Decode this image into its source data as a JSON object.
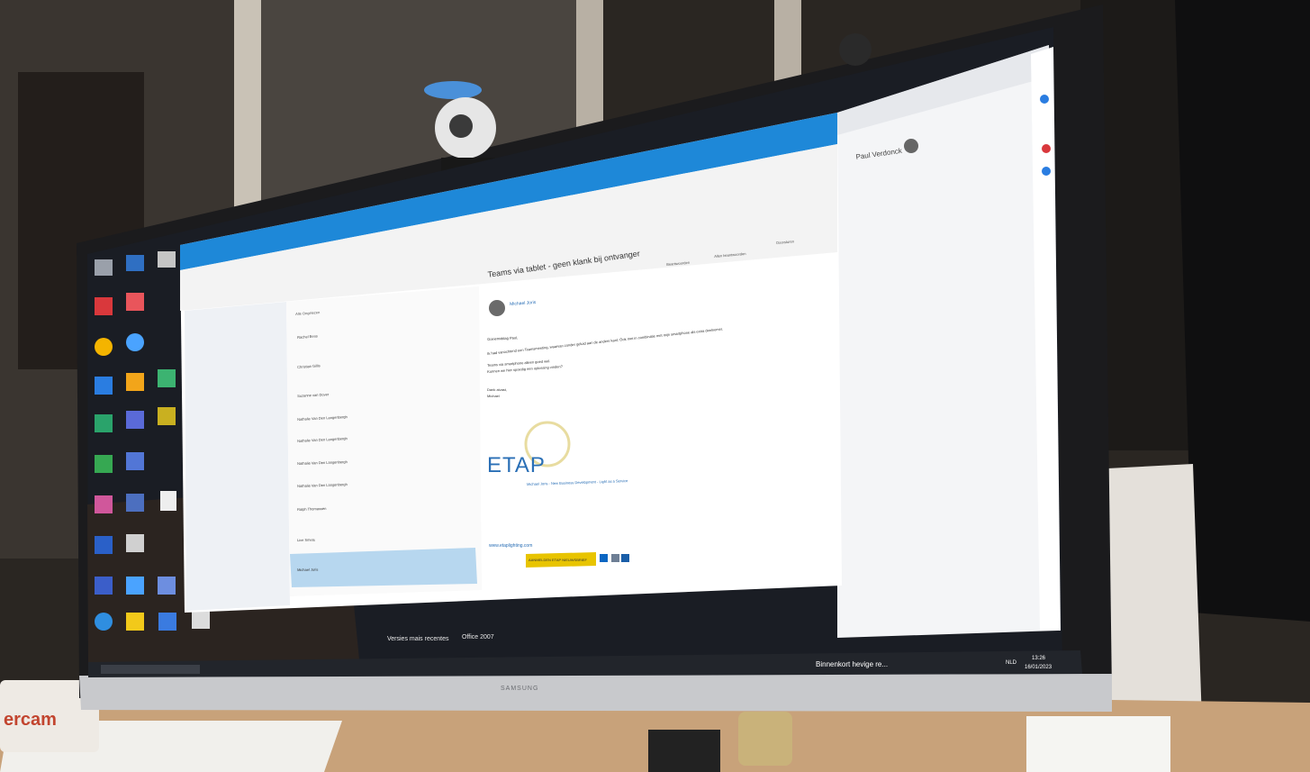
{
  "email": {
    "subject": "Teams via tablet - geen klank bij ontvanger",
    "sender_name": "Michael Joris",
    "greeting": "Goeiemiddag Paul,",
    "body_line_1": "Ik had vanochtend een Teamsmeeting, waarvan zonder geluid aan de andere kant. Ook met in combinatie met mijn smartphone als extra deelnemer.",
    "body_line_2": "Teams via smartphone alleen goed wel.",
    "body_line_3": "Kunnen we hier spoedig een oplossing vinden?",
    "closing": "Dank alvast,",
    "closing_name": "Michael",
    "logo_text": "ETAP",
    "signature_line": "Michael Joris - New Business Development - Light as a Service",
    "website": "www.etaplighting.com",
    "banner": "AANMELDEN ETAP NIEUWSBRIEF"
  },
  "reading_toolbar": {
    "reply_all": "Allen beantwoorden",
    "forward": "Doorsturen",
    "reply": "Beantwoorden"
  },
  "browser": {
    "profile_label": "Paul Verdonck"
  },
  "inbox": {
    "header": "Alle  Ongelezen",
    "messages": [
      {
        "sender": "Rachel Bens"
      },
      {
        "sender": "Christian Gillis"
      },
      {
        "sender": "Suzanne van Dover"
      },
      {
        "sender": "Nathalie Van Den Langenbergh"
      },
      {
        "sender": "Nathalie Van Den Langenbergh"
      },
      {
        "sender": "Nathalie Van Den Langenbergh"
      },
      {
        "sender": "Nathalie Van Den Langenbergh"
      },
      {
        "sender": "Ralph Thomassen"
      },
      {
        "sender": "Live Smets"
      },
      {
        "sender": "Michael Joris"
      }
    ]
  },
  "desktop": {
    "folder_label_1": "Versies mais recentes",
    "folder_label_2": "Office 2007"
  },
  "taskbar": {
    "notification": "Binnenkort hevige re...",
    "language": "NLD",
    "time": "13:26",
    "date": "16/01/2023"
  },
  "monitor": {
    "brand": "SAMSUNG"
  },
  "desk": {
    "box_label": "ercam"
  },
  "colors": {
    "outlook_blue": "#1e88d8",
    "wall_dark": "#2a2622",
    "screen_white": "#f4f5f7",
    "desk_wood": "#c8a27a",
    "banner_yellow": "#e8c400",
    "etap_blue": "#2a6fb6"
  }
}
